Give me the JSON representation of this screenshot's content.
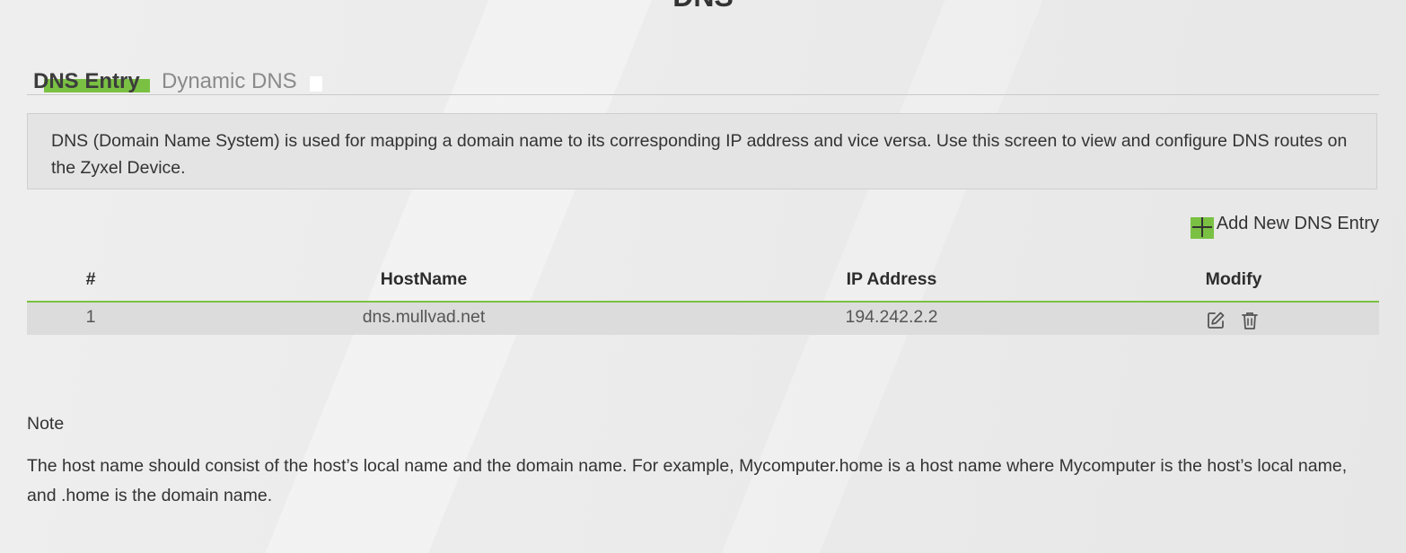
{
  "page": {
    "title": "DNS"
  },
  "tabs": [
    {
      "label": "DNS Entry",
      "active": true
    },
    {
      "label": "Dynamic DNS",
      "active": false
    }
  ],
  "info": {
    "text": "DNS (Domain Name System) is used for mapping a domain name to its corresponding IP address and vice versa. Use this screen to view and configure DNS routes on the Zyxel Device."
  },
  "actions": {
    "add_label": "Add New DNS Entry",
    "add_icon": "plus-icon"
  },
  "table": {
    "columns": [
      "#",
      "HostName",
      "IP Address",
      "Modify"
    ],
    "rows": [
      {
        "index": "1",
        "hostname": "dns.mullvad.net",
        "ip": "194.242.2.2",
        "modify_icons": [
          "edit-icon",
          "trash-icon"
        ]
      }
    ]
  },
  "note": {
    "title": "Note",
    "text": "The host name should consist of the host’s local name and the domain name. For example, Mycomputer.home is a host name where Mycomputer is the host’s local name, and .home is the domain name."
  },
  "colors": {
    "accent": "#7ac143",
    "background": "#ececec",
    "text": "#333333"
  }
}
